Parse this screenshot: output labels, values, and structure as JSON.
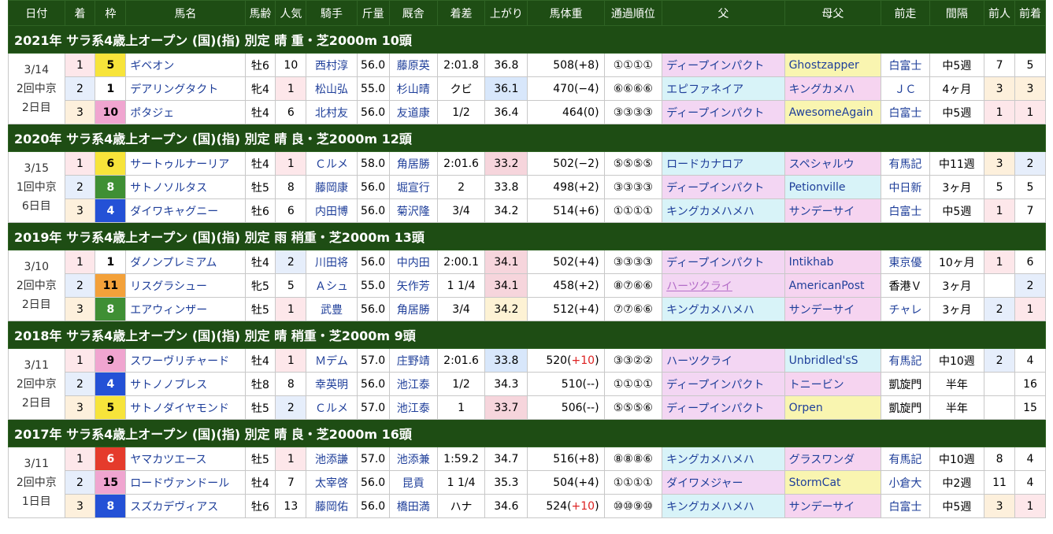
{
  "headers": [
    "日付",
    "着",
    "枠",
    "馬名",
    "馬齢",
    "人気",
    "騎手",
    "斤量",
    "厩舎",
    "着差",
    "上がり",
    "馬体重",
    "通過順位",
    "父",
    "母父",
    "前走",
    "間隔",
    "前人",
    "前着"
  ],
  "races": [
    {
      "title": "2021年 サラ系4歳上オープン (国)(指) 別定 晴 重・芝2000m 10頭",
      "date": [
        "3/14",
        "2回中京",
        "2日目"
      ],
      "rows": [
        {
          "rank": "1",
          "waku": "5",
          "wcls": "w5",
          "name": "ギベオン",
          "age": "牡6",
          "pop": "10",
          "jockey": "西村淳",
          "kin": "56.0",
          "stable": "藤原英",
          "margin": "2:01.8",
          "agari": "36.8",
          "acls": "",
          "weight": "508(+8)",
          "wplus": "",
          "pass": "①①①①",
          "sire": "ディープインパクト",
          "scls": "sire-bg",
          "bms": "Ghostzapper",
          "bcls": "bms-bg",
          "prev": "白富士",
          "pcls": "",
          "interval": "中5週",
          "pp": "7",
          "ppcls": "",
          "pr": "5",
          "prcls": ""
        },
        {
          "rank": "2",
          "waku": "1",
          "wcls": "w1",
          "name": "デアリングタクト",
          "age": "牝4",
          "pop": "1",
          "jockey": "松山弘",
          "kin": "55.0",
          "stable": "杉山晴",
          "margin": "クビ",
          "agari": "36.1",
          "acls": "agari-blue",
          "weight": "470(−4)",
          "wplus": "",
          "pass": "⑥⑥⑥⑥",
          "sire": "エピファネイア",
          "scls": "sire-cyan",
          "bms": "キングカメハ",
          "bcls": "bms-pink",
          "prev": "ＪＣ",
          "pcls": "",
          "interval": "4ヶ月",
          "pp": "3",
          "ppcls": "maen-3",
          "pr": "3",
          "prcls": "maen-3"
        },
        {
          "rank": "3",
          "waku": "10",
          "wcls": "w8",
          "name": "ポタジェ",
          "age": "牡4",
          "pop": "6",
          "jockey": "北村友",
          "kin": "56.0",
          "stable": "友道康",
          "margin": "1/2",
          "agari": "36.4",
          "acls": "",
          "weight": "464(0)",
          "wplus": "",
          "pass": "③③③③",
          "sire": "ディープインパクト",
          "scls": "sire-bg",
          "bms": "AwesomeAgain",
          "bcls": "bms-bg",
          "prev": "白富士",
          "pcls": "",
          "interval": "中5週",
          "pp": "1",
          "ppcls": "maen-1",
          "pr": "1",
          "prcls": "maen-1"
        }
      ]
    },
    {
      "title": "2020年 サラ系4歳上オープン (国)(指) 別定 晴 良・芝2000m 12頭",
      "date": [
        "3/15",
        "1回中京",
        "6日目"
      ],
      "rows": [
        {
          "rank": "1",
          "waku": "6",
          "wcls": "w5",
          "name": "サートゥルナーリア",
          "age": "牡4",
          "pop": "1",
          "jockey": "Ｃルメ",
          "kin": "58.0",
          "stable": "角居勝",
          "margin": "2:01.6",
          "agari": "33.2",
          "acls": "agari-red",
          "weight": "502(−2)",
          "wplus": "",
          "pass": "⑤⑤⑤⑤",
          "sire": "ロードカナロア",
          "scls": "sire-cyan",
          "bms": "スペシャルウ",
          "bcls": "bms-pink",
          "prev": "有馬記",
          "pcls": "",
          "interval": "中11週",
          "pp": "3",
          "ppcls": "maen-3",
          "pr": "2",
          "prcls": "maen-2"
        },
        {
          "rank": "2",
          "waku": "8",
          "wcls": "w6",
          "name": "サトノソルタス",
          "age": "牡5",
          "pop": "8",
          "jockey": "藤岡康",
          "kin": "56.0",
          "stable": "堀宣行",
          "margin": "2",
          "agari": "33.8",
          "acls": "",
          "weight": "498(+2)",
          "wplus": "",
          "pass": "③③③③",
          "sire": "ディープインパクト",
          "scls": "sire-bg",
          "bms": "Petionville",
          "bcls": "bms-cyan",
          "prev": "中日新",
          "pcls": "",
          "interval": "3ヶ月",
          "pp": "5",
          "ppcls": "",
          "pr": "5",
          "prcls": ""
        },
        {
          "rank": "3",
          "waku": "4",
          "wcls": "w4",
          "name": "ダイワキャグニー",
          "age": "牡6",
          "pop": "6",
          "jockey": "内田博",
          "kin": "56.0",
          "stable": "菊沢隆",
          "margin": "3/4",
          "agari": "34.2",
          "acls": "",
          "weight": "514(+6)",
          "wplus": "",
          "pass": "①①①①",
          "sire": "キングカメハメハ",
          "scls": "sire-cyan",
          "bms": "サンデーサイ",
          "bcls": "bms-pink",
          "prev": "白富士",
          "pcls": "",
          "interval": "中5週",
          "pp": "1",
          "ppcls": "maen-1",
          "pr": "7",
          "prcls": ""
        }
      ]
    },
    {
      "title": "2019年 サラ系4歳上オープン (国)(指) 別定 雨 稍重・芝2000m 13頭",
      "date": [
        "3/10",
        "2回中京",
        "2日目"
      ],
      "rows": [
        {
          "rank": "1",
          "waku": "1",
          "wcls": "w1",
          "name": "ダノンプレミアム",
          "age": "牡4",
          "pop": "2",
          "jockey": "川田将",
          "kin": "56.0",
          "stable": "中内田",
          "margin": "2:00.1",
          "agari": "34.1",
          "acls": "agari-red",
          "weight": "502(+4)",
          "wplus": "",
          "pass": "③③③③",
          "sire": "ディープインパクト",
          "scls": "sire-bg",
          "bms": "Intikhab",
          "bcls": "bms-pink",
          "prev": "東京優",
          "pcls": "",
          "interval": "10ヶ月",
          "pp": "1",
          "ppcls": "maen-1",
          "pr": "6",
          "prcls": ""
        },
        {
          "rank": "2",
          "waku": "11",
          "wcls": "w7",
          "name": "リスグラシュー",
          "age": "牝5",
          "pop": "5",
          "jockey": "Ａシュ",
          "kin": "55.0",
          "stable": "矢作芳",
          "margin": "1 1/4",
          "agari": "34.1",
          "acls": "agari-red",
          "weight": "458(+2)",
          "wplus": "",
          "pass": "⑧⑦⑥⑥",
          "sire": "ハーツクライ",
          "scls": "sire-bg",
          "bms": "AmericanPost",
          "bcls": "bms-pink",
          "prev": "香港Ｖ",
          "pcls": "",
          "interval": "3ヶ月",
          "pp": "",
          "ppcls": "",
          "pr": "2",
          "prcls": "maen-2"
        },
        {
          "rank": "3",
          "waku": "8",
          "wcls": "w6",
          "name": "エアウィンザー",
          "age": "牡5",
          "pop": "1",
          "jockey": "武豊",
          "kin": "56.0",
          "stable": "角居勝",
          "margin": "3/4",
          "agari": "34.2",
          "acls": "agari-yellow",
          "weight": "512(+4)",
          "wplus": "",
          "pass": "⑦⑦⑥⑥",
          "sire": "キングカメハメハ",
          "scls": "sire-cyan",
          "bms": "サンデーサイ",
          "bcls": "bms-pink",
          "prev": "チャレ",
          "pcls": "",
          "interval": "3ヶ月",
          "pp": "2",
          "ppcls": "maen-2",
          "pr": "1",
          "prcls": "maen-1"
        }
      ]
    },
    {
      "title": "2018年 サラ系4歳上オープン (国)(指) 別定 晴 稍重・芝2000m 9頭",
      "date": [
        "3/11",
        "2回中京",
        "2日目"
      ],
      "rows": [
        {
          "rank": "1",
          "waku": "9",
          "wcls": "w8",
          "name": "スワーヴリチャード",
          "age": "牡4",
          "pop": "1",
          "jockey": "Ｍデム",
          "kin": "57.0",
          "stable": "庄野靖",
          "margin": "2:01.6",
          "agari": "33.8",
          "acls": "agari-blue",
          "weight": "520(",
          "wplus": "+10",
          "wend": ")",
          "pass": "③③②②",
          "sire": "ハーツクライ",
          "scls": "sire-bg",
          "bms": "Unbridled'sS",
          "bcls": "bms-cyan",
          "prev": "有馬記",
          "pcls": "",
          "interval": "中10週",
          "pp": "2",
          "ppcls": "maen-2",
          "pr": "4",
          "prcls": ""
        },
        {
          "rank": "2",
          "waku": "4",
          "wcls": "w4",
          "name": "サトノノブレス",
          "age": "牡8",
          "pop": "8",
          "jockey": "幸英明",
          "kin": "56.0",
          "stable": "池江泰",
          "margin": "1/2",
          "agari": "34.3",
          "acls": "",
          "weight": "510(--)",
          "wplus": "",
          "pass": "①①①①",
          "sire": "ディープインパクト",
          "scls": "sire-bg",
          "bms": "トニービン",
          "bcls": "bms-pink",
          "prev": "凱旋門",
          "pcls": "",
          "interval": "半年",
          "pp": "",
          "ppcls": "",
          "pr": "16",
          "prcls": ""
        },
        {
          "rank": "3",
          "waku": "5",
          "wcls": "w5",
          "name": "サトノダイヤモンド",
          "age": "牡5",
          "pop": "2",
          "jockey": "Ｃルメ",
          "kin": "57.0",
          "stable": "池江泰",
          "margin": "1",
          "agari": "33.7",
          "acls": "agari-red",
          "weight": "506(--)",
          "wplus": "",
          "pass": "⑤⑤⑤⑥",
          "sire": "ディープインパクト",
          "scls": "sire-bg",
          "bms": "Orpen",
          "bcls": "bms-bg",
          "prev": "凱旋門",
          "pcls": "",
          "interval": "半年",
          "pp": "",
          "ppcls": "",
          "pr": "15",
          "prcls": ""
        }
      ]
    },
    {
      "title": "2017年 サラ系4歳上オープン (国)(指) 別定 晴 良・芝2000m 16頭",
      "date": [
        "3/11",
        "2回中京",
        "1日目"
      ],
      "rows": [
        {
          "rank": "1",
          "waku": "6",
          "wcls": "w3",
          "name": "ヤマカツエース",
          "age": "牡5",
          "pop": "1",
          "jockey": "池添謙",
          "kin": "57.0",
          "stable": "池添兼",
          "margin": "1:59.2",
          "agari": "34.7",
          "acls": "",
          "weight": "516(+8)",
          "wplus": "",
          "pass": "⑧⑧⑧⑥",
          "sire": "キングカメハメハ",
          "scls": "sire-cyan",
          "bms": "グラスワンダ",
          "bcls": "bms-pink",
          "prev": "有馬記",
          "pcls": "",
          "interval": "中10週",
          "pp": "8",
          "ppcls": "",
          "pr": "4",
          "prcls": ""
        },
        {
          "rank": "2",
          "waku": "15",
          "wcls": "w8",
          "name": "ロードヴァンドール",
          "age": "牡4",
          "pop": "7",
          "jockey": "太宰啓",
          "kin": "56.0",
          "stable": "昆貢",
          "margin": "1 1/4",
          "agari": "35.3",
          "acls": "",
          "weight": "504(+4)",
          "wplus": "",
          "pass": "①①①①",
          "sire": "ダイワメジャー",
          "scls": "sire-bg",
          "bms": "StormCat",
          "bcls": "bms-bg",
          "prev": "小倉大",
          "pcls": "",
          "interval": "中2週",
          "pp": "11",
          "ppcls": "",
          "pr": "4",
          "prcls": ""
        },
        {
          "rank": "3",
          "waku": "8",
          "wcls": "w4",
          "name": "スズカデヴィアス",
          "age": "牡6",
          "pop": "13",
          "jockey": "藤岡佑",
          "kin": "56.0",
          "stable": "橋田満",
          "margin": "ハナ",
          "agari": "34.6",
          "acls": "",
          "weight": "524(",
          "wplus": "+10",
          "wend": ")",
          "pass": "⑩⑩⑨⑩",
          "sire": "キングカメハメハ",
          "scls": "sire-cyan",
          "bms": "サンデーサイ",
          "bcls": "bms-pink",
          "prev": "白富士",
          "pcls": "",
          "interval": "中5週",
          "pp": "3",
          "ppcls": "maen-3",
          "pr": "1",
          "prcls": "maen-1"
        }
      ]
    }
  ]
}
